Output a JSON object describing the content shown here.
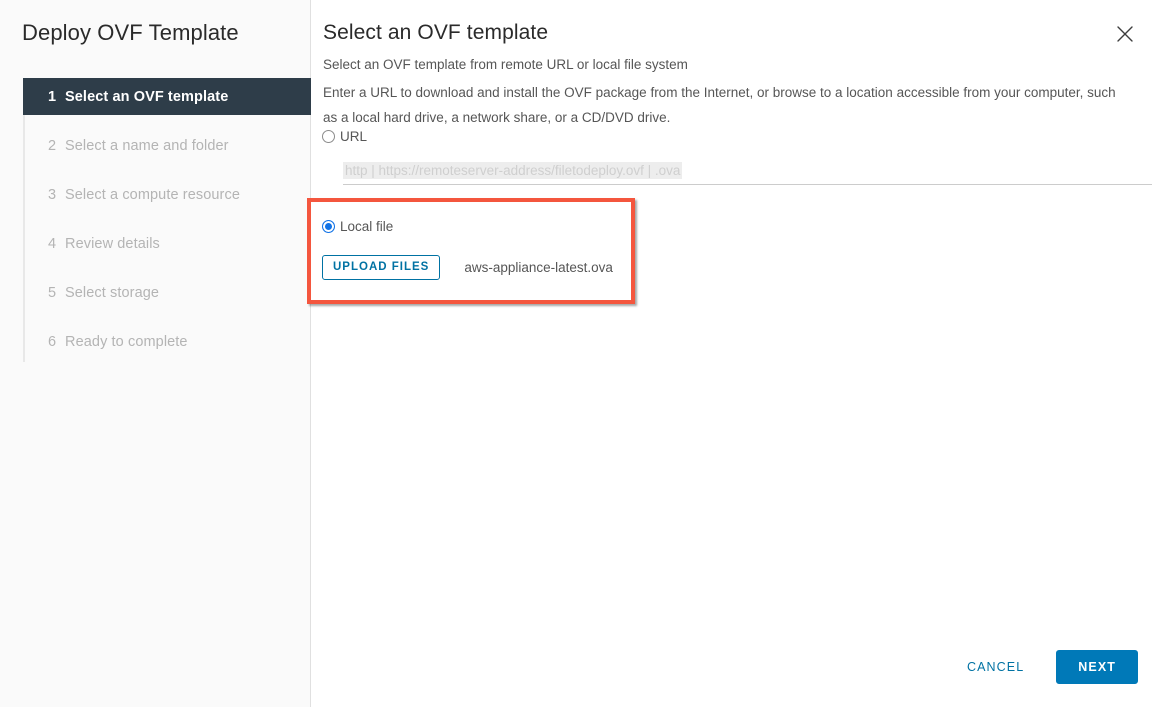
{
  "wizard": {
    "title": "Deploy OVF Template",
    "steps": [
      {
        "num": "1",
        "label": "Select an OVF template"
      },
      {
        "num": "2",
        "label": "Select a name and folder"
      },
      {
        "num": "3",
        "label": "Select a compute resource"
      },
      {
        "num": "4",
        "label": "Review details"
      },
      {
        "num": "5",
        "label": "Select storage"
      },
      {
        "num": "6",
        "label": "Ready to complete"
      }
    ]
  },
  "pane": {
    "title": "Select an OVF template",
    "subtitle": "Select an OVF template from remote URL or local file system",
    "description": "Enter a URL to download and install the OVF package from the Internet, or browse to a location accessible from your computer, such as a local hard drive, a network share, or a CD/DVD drive.",
    "close_icon": "close-icon"
  },
  "source": {
    "url_option_label": "URL",
    "url_input_value": "",
    "url_placeholder": "http | https://remoteserver-address/filetodeploy.ovf | .ova",
    "local_option_label": "Local file",
    "upload_button_label": "UPLOAD FILES",
    "selected_file": "aws-appliance-latest.ova",
    "selected_option": "local"
  },
  "footer": {
    "cancel_label": "CANCEL",
    "next_label": "NEXT"
  },
  "colors": {
    "accent_blue": "#0079b8",
    "link_blue": "#0072a3",
    "radio_blue": "#1273e6",
    "active_step_bg": "#2e3d49",
    "highlight_red": "#f4563e",
    "sidebar_bg": "#fafafa"
  }
}
